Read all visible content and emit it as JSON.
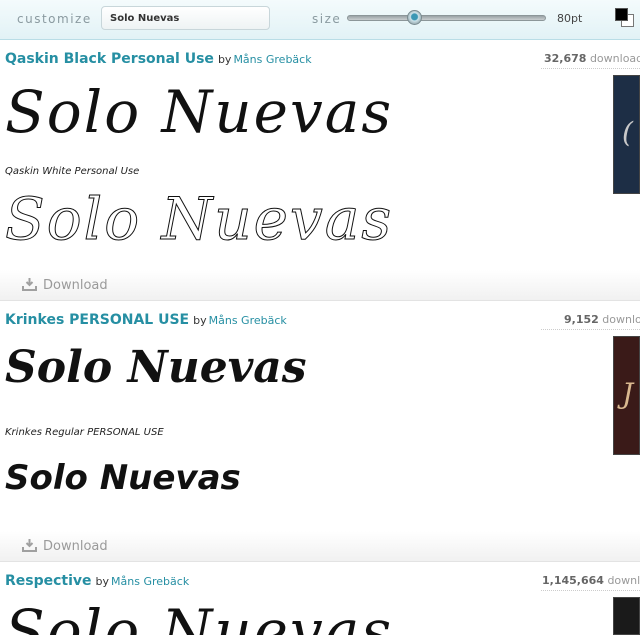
{
  "toolbar": {
    "customize_label": "customize",
    "preview_text": "Solo Nuevas",
    "size_label": "size",
    "size_value": "80pt",
    "size_slider_fraction": 0.34,
    "foreground_color": "#000000",
    "background_color": "#ffffff"
  },
  "entries": [
    {
      "title": "Qaskin Black Personal Use",
      "by": "by",
      "author": "Måns Grebäck",
      "download_count": "32,678",
      "download_suffix": "downloads",
      "preview": "Solo Nuevas",
      "style_label": "Qaskin White Personal Use",
      "style_preview": "Solo Nuevas",
      "download_label": "Download",
      "thumb_color": "#1d2e45"
    },
    {
      "title": "Krinkes PERSONAL USE",
      "by": "by",
      "author": "Måns Grebäck",
      "download_count": "9,152",
      "download_suffix": "downloads",
      "preview": "Solo Nuevas",
      "style_label": "Krinkes Regular PERSONAL USE",
      "style_preview": "Solo Nuevas",
      "download_label": "Download",
      "thumb_color": "#3a1a18"
    },
    {
      "title": "Respective",
      "by": "by",
      "author": "Måns Grebäck",
      "download_count": "1,145,664",
      "download_suffix": "downloads",
      "preview": "Solo Nuevas",
      "thumb_color": "#1a1a1a"
    }
  ],
  "accent_color": "#268fa3"
}
